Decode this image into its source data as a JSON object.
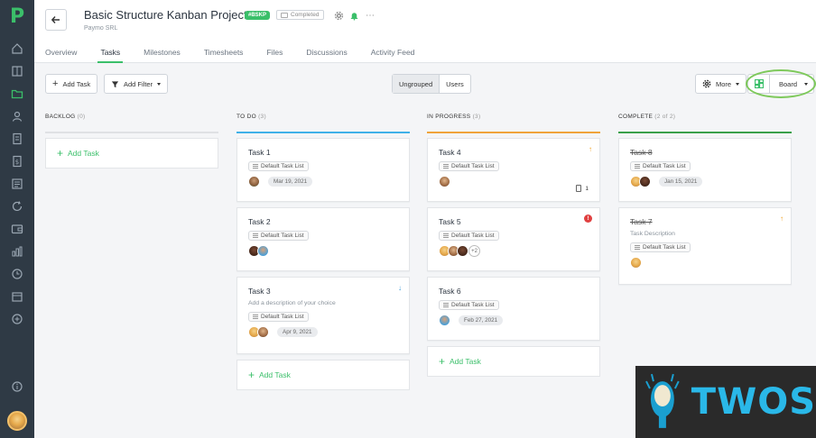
{
  "sidebar": {
    "icons": [
      "home-icon",
      "building-icon",
      "folder-icon",
      "user-icon",
      "document-icon",
      "dollar-icon",
      "report-icon",
      "refresh-icon",
      "wallet-icon",
      "chart-icon",
      "clock-icon",
      "calendar-icon",
      "add-circle-icon"
    ],
    "active_index": 2
  },
  "header": {
    "title": "Basic Structure Kanban Project",
    "tag": "#BSKP",
    "status": "Completed",
    "company": "Paymo SRL"
  },
  "tabs": [
    "Overview",
    "Tasks",
    "Milestones",
    "Timesheets",
    "Files",
    "Discussions",
    "Activity Feed"
  ],
  "active_tab": "Tasks",
  "toolbar": {
    "add_task": "Add Task",
    "add_filter": "Add Filter",
    "group_ungrouped": "Ungrouped",
    "group_users": "Users",
    "more": "More",
    "view": "Board"
  },
  "columns": [
    {
      "name": "BACKLOG",
      "count": "(0)",
      "color": "#dfe1e4",
      "add_label": "Add Task"
    },
    {
      "name": "TO DO",
      "count": "(3)",
      "color": "#3fb0e8",
      "cards": [
        {
          "title": "Task 1",
          "list": "Default Task List",
          "date": "Mar 19, 2021"
        },
        {
          "title": "Task 2",
          "list": "Default Task List"
        },
        {
          "title": "Task 3",
          "desc": "Add a description of your choice",
          "list": "Default Task List",
          "date": "Apr 9, 2021",
          "priority": "↓"
        }
      ],
      "add_label": "Add Task"
    },
    {
      "name": "IN PROGRESS",
      "count": "(3)",
      "color": "#f0a33a",
      "cards": [
        {
          "title": "Task 4",
          "list": "Default Task List",
          "priority": "↑",
          "attachments": "1"
        },
        {
          "title": "Task 5",
          "list": "Default Task List",
          "priority": "!",
          "more": "+2"
        },
        {
          "title": "Task 6",
          "list": "Default Task List",
          "date": "Feb 27, 2021"
        }
      ],
      "add_label": "Add Task"
    },
    {
      "name": "COMPLETE",
      "count": "(2 of 2)",
      "color": "#3aa04a",
      "cards": [
        {
          "title": "Task 8",
          "list": "Default Task List",
          "date": "Jan 15, 2021"
        },
        {
          "title": "Task 7",
          "desc": "Task Description",
          "list": "Default Task List",
          "priority": "↑"
        }
      ]
    }
  ],
  "watermark": "TWOS"
}
